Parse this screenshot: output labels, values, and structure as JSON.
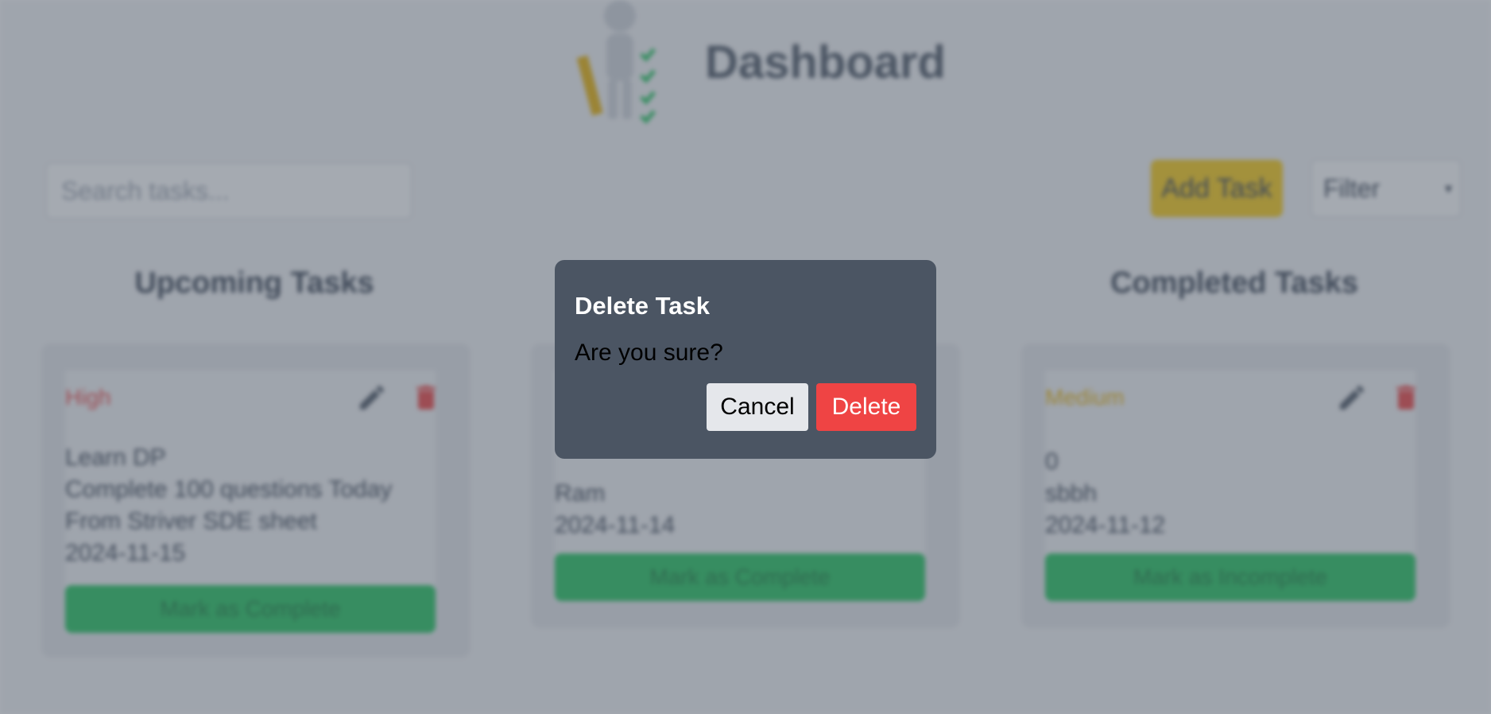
{
  "header": {
    "title": "Dashboard"
  },
  "toolbar": {
    "search_placeholder": "Search tasks...",
    "add_label": "Add Task",
    "filter_value": "Filter"
  },
  "columns": [
    {
      "title": "Upcoming Tasks",
      "card": {
        "priority": "High",
        "priority_color": "#ef4444",
        "lines": [
          "Learn DP",
          "Complete 100 questions Today",
          "From Striver SDE sheet",
          "2024-11-15"
        ],
        "button": "Mark as Complete"
      }
    },
    {
      "title": "",
      "card": {
        "priority": "",
        "lines": [
          "",
          "Ram",
          "2024-11-14"
        ],
        "button": "Mark as Complete"
      }
    },
    {
      "title": "Completed Tasks",
      "card": {
        "priority": "Medium",
        "priority_color": "#eab308",
        "lines": [
          "0",
          "sbbh",
          "2024-11-12"
        ],
        "button": "Mark as Incomplete"
      }
    }
  ],
  "modal": {
    "title": "Delete Task",
    "message": "Are you sure?",
    "cancel_label": "Cancel",
    "delete_label": "Delete"
  },
  "colors": {
    "modal_bg": "#4b5563",
    "delete": "#ef4444",
    "add_task": "#facc15",
    "complete": "#22c55e"
  }
}
